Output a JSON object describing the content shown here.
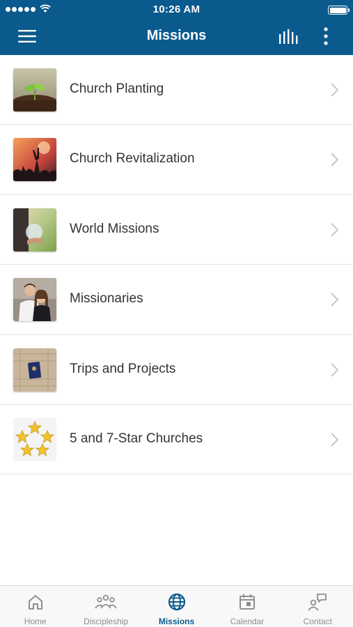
{
  "status_bar": {
    "time": "10:26 AM"
  },
  "header": {
    "title": "Missions",
    "icons": [
      "menu-icon",
      "bar-chart-icon",
      "more-vertical-icon"
    ]
  },
  "list": [
    {
      "label": "Church Planting"
    },
    {
      "label": "Church Revitalization"
    },
    {
      "label": "World Missions"
    },
    {
      "label": "Missionaries"
    },
    {
      "label": "Trips and Projects"
    },
    {
      "label": "5 and 7-Star Churches"
    }
  ],
  "tabs": [
    {
      "label": "Home",
      "icon": "home-icon"
    },
    {
      "label": "Discipleship",
      "icon": "group-icon"
    },
    {
      "label": "Missions",
      "icon": "globe-icon",
      "active": true
    },
    {
      "label": "Calendar",
      "icon": "calendar-icon"
    },
    {
      "label": "Contact",
      "icon": "contact-icon"
    }
  ],
  "colors": {
    "header_bg": "#0b5a8e",
    "active_tab": "#0b5a8e",
    "inactive_tab": "#8e8e8e"
  }
}
